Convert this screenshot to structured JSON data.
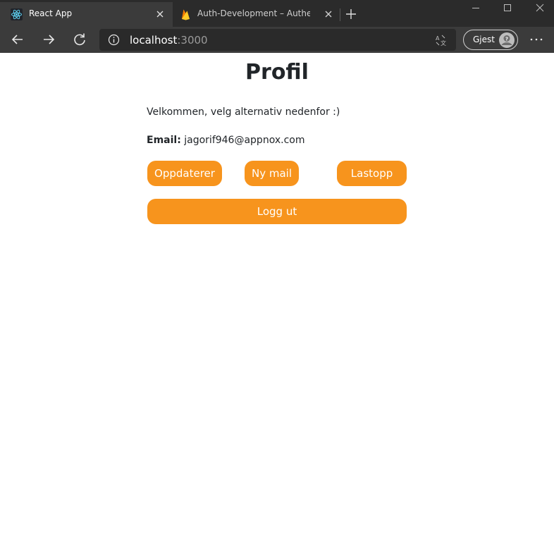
{
  "browser": {
    "tabs": [
      {
        "title": "React App",
        "favicon": "react-logo-icon",
        "active": true
      },
      {
        "title": "Auth-Development – Authenticat",
        "favicon": "firebase-logo-icon",
        "active": false
      }
    ],
    "address": {
      "host": "localhost",
      "port": ":3000"
    },
    "profile_label": "Gjest",
    "colors": {
      "chrome": "#2b2b2b",
      "toolbar": "#3b3b3b",
      "accent": "#f7941d"
    }
  },
  "page": {
    "title": "Profil",
    "welcome": "Velkommen, velg alternativ nedenfor :)",
    "email_label": "Email:",
    "email_value": "jagorif946@appnox.com",
    "buttons": {
      "update": "Oppdaterer",
      "new_mail": "Ny mail",
      "upload": "Lastopp",
      "logout": "Logg ut"
    }
  }
}
